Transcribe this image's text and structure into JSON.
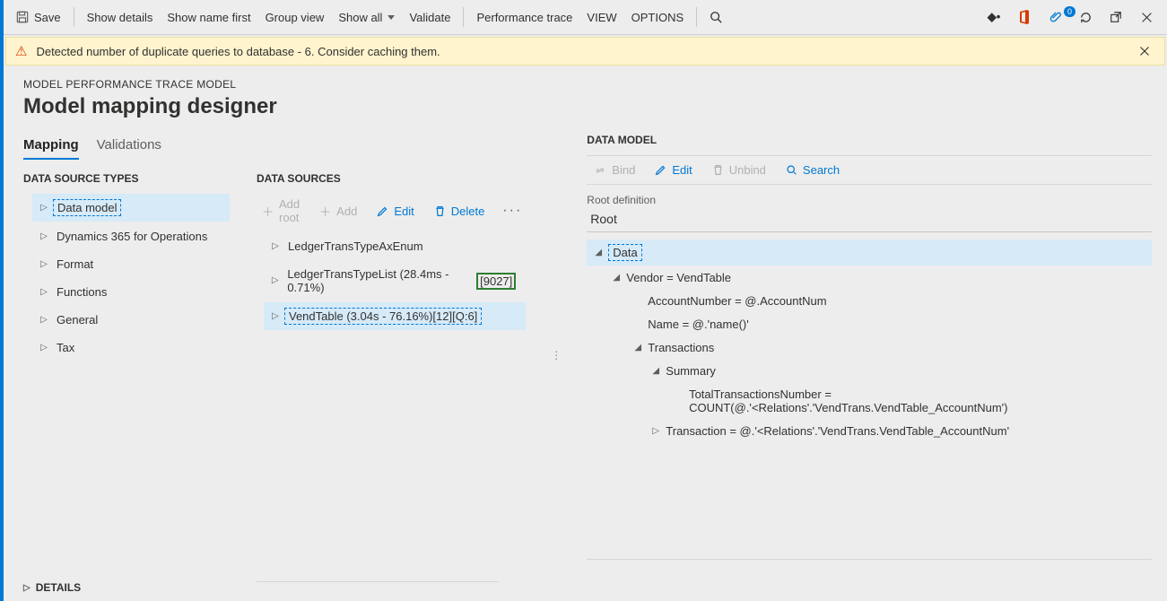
{
  "toolbar": {
    "save": "Save",
    "showDetails": "Show details",
    "showNameFirst": "Show name first",
    "groupView": "Group view",
    "showAll": "Show all",
    "validate": "Validate",
    "perfTrace": "Performance trace",
    "view": "VIEW",
    "options": "OPTIONS",
    "badge": "0"
  },
  "warning": {
    "text": "Detected number of duplicate queries to database - 6. Consider caching them."
  },
  "breadcrumb": "MODEL PERFORMANCE TRACE MODEL",
  "pageTitle": "Model mapping designer",
  "tabs": {
    "mapping": "Mapping",
    "validations": "Validations"
  },
  "dstTitle": "DATA SOURCE TYPES",
  "dstItems": [
    "Data model",
    "Dynamics 365 for Operations",
    "Format",
    "Functions",
    "General",
    "Tax"
  ],
  "dsTitle": "DATA SOURCES",
  "dsButtons": {
    "addRoot": "Add root",
    "add": "Add",
    "edit": "Edit",
    "delete": "Delete"
  },
  "dsItems": {
    "item0": "LedgerTransTypeAxEnum",
    "item1_main": "LedgerTransTypeList (28.4ms - 0.71%)",
    "item1_green": "[9027]",
    "item2": "VendTable (3.04s - 76.16%)[12][Q:6]"
  },
  "dmTitle": "DATA MODEL",
  "dmButtons": {
    "bind": "Bind",
    "edit": "Edit",
    "unbind": "Unbind",
    "search": "Search"
  },
  "dmField": {
    "label": "Root definition",
    "value": "Root"
  },
  "dmTree": {
    "r0": "Data",
    "r1": "Vendor = VendTable",
    "r2": "AccountNumber = @.AccountNum",
    "r3": "Name = @.'name()'",
    "r4": "Transactions",
    "r5": "Summary",
    "r6": "TotalTransactionsNumber = COUNT(@.'<Relations'.'VendTrans.VendTable_AccountNum')",
    "r7": "Transaction = @.'<Relations'.'VendTrans.VendTable_AccountNum'"
  },
  "details": "DETAILS"
}
